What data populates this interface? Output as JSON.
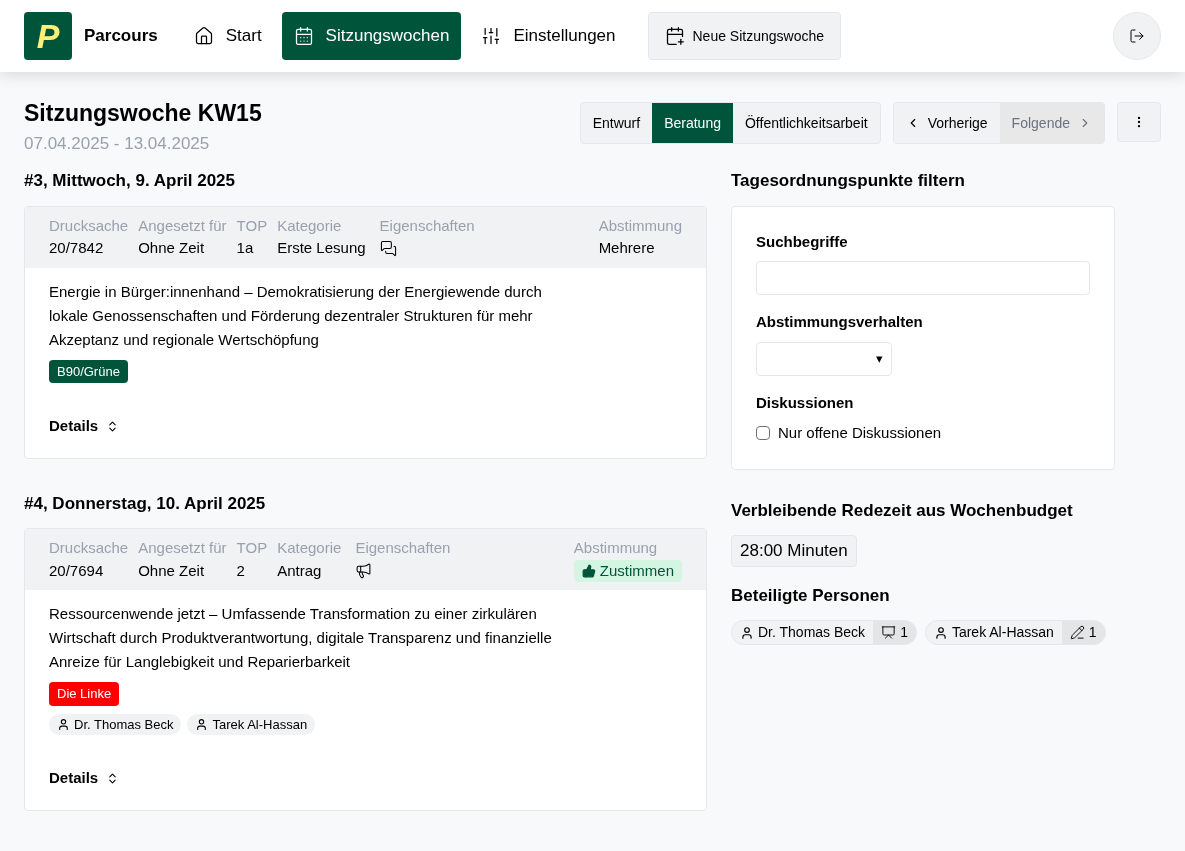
{
  "header": {
    "logo": "P",
    "brand": "Parcours",
    "nav": [
      {
        "label": "Start",
        "kind": "home",
        "selected": false
      },
      {
        "label": "Sitzungswochen",
        "kind": "calendar",
        "selected": true
      },
      {
        "label": "Einstellungen",
        "kind": "sliders",
        "selected": false
      }
    ],
    "new_button": "Neue Sitzungswoche"
  },
  "week": {
    "title": "Sitzungswoche KW15",
    "dates": "07.04.2025 - 13.04.2025",
    "phases": [
      {
        "label": "Entwurf",
        "selected": false
      },
      {
        "label": "Beratung",
        "selected": true
      },
      {
        "label": "Öffentlichkeitsarbeit",
        "selected": false
      }
    ],
    "prev": {
      "label": "Vorherige",
      "disabled": false
    },
    "next": {
      "label": "Folgende",
      "disabled": true
    }
  },
  "sessions": [
    {
      "heading": "#3, Mittwoch, 9. April 2025",
      "columns": [
        {
          "label": "Drucksache",
          "value": "20/7842"
        },
        {
          "label": "Angesetzt für",
          "value": "Ohne Zeit"
        },
        {
          "label": "TOP",
          "value": "1a"
        },
        {
          "label": "Kategorie",
          "value": "Erste Lesung"
        }
      ],
      "properties": {
        "label": "Eigenschaften",
        "kind": "discussion"
      },
      "vote": {
        "label": "Abstimmung",
        "value": "Mehrere",
        "kind": "text"
      },
      "title": "Energie in Bürger:innenhand – Demokratisierung der Energiewende durch lokale Genossenschaften und Förderung dezentraler Strukturen für mehr Akzeptanz und regionale Wertschöpfung",
      "party": {
        "label": "B90/Grüne",
        "color": "#00543a"
      },
      "details": "Details"
    },
    {
      "heading": "#4, Donnerstag, 10. April 2025",
      "columns": [
        {
          "label": "Drucksache",
          "value": "20/7694"
        },
        {
          "label": "Angesetzt für",
          "value": "Ohne Zeit"
        },
        {
          "label": "TOP",
          "value": "2"
        },
        {
          "label": "Kategorie",
          "value": "Antrag"
        }
      ],
      "properties": {
        "label": "Eigenschaften",
        "kind": "announcement"
      },
      "vote": {
        "label": "Abstimmung",
        "value": "Zustimmen",
        "kind": "approve"
      },
      "title": "Ressourcenwende jetzt – Umfassende Transformation zu einer zirkulären Wirtschaft durch Produktverantwortung, digitale Transparenz und finanzielle Anreize für Langlebigkeit und Reparierbarkeit",
      "party": {
        "label": "Die Linke",
        "color": "#ff0000"
      },
      "people": [
        "Dr. Thomas Beck",
        "Tarek Al-Hassan"
      ],
      "details": "Details"
    }
  ],
  "filter": {
    "title": "Tagesordnungspunkte filtern",
    "search_label": "Suchbegriffe",
    "vote_label": "Abstimmungsverhalten",
    "dropdown_caret": "▾",
    "discussions_label": "Diskussionen",
    "checkbox": {
      "label": "Nur offene Diskussionen",
      "checked": false
    }
  },
  "budget": {
    "title": "Verbleibende Redezeit aus Wochenbudget",
    "value": "28:00 Minuten"
  },
  "persons": {
    "title": "Beteiligte Personen",
    "items": [
      {
        "name": "Dr. Thomas Beck",
        "kind": "speech",
        "count": "1"
      },
      {
        "name": "Tarek Al-Hassan",
        "kind": "writing",
        "count": "1"
      }
    ]
  }
}
